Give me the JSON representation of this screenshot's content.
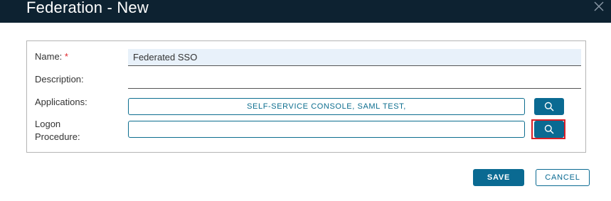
{
  "dialog": {
    "title": "Federation - New",
    "close_icon": "close-icon"
  },
  "form": {
    "name": {
      "label": "Name:",
      "required_marker": "*",
      "value": "Federated SSO"
    },
    "description": {
      "label": "Description:",
      "value": ""
    },
    "applications": {
      "label": "Applications:",
      "value": "SELF-SERVICE CONSOLE, SAML TEST,",
      "search_icon": "search-icon"
    },
    "logon_procedure": {
      "label_line1": "Logon",
      "label_line2": "Procedure:",
      "value": "",
      "search_icon": "search-icon"
    }
  },
  "actions": {
    "save_label": "SAVE",
    "cancel_label": "CANCEL"
  },
  "colors": {
    "titlebar": "#0d2231",
    "accent": "#0a6a92",
    "highlight": "#d91f26",
    "required": "#e0262b"
  }
}
